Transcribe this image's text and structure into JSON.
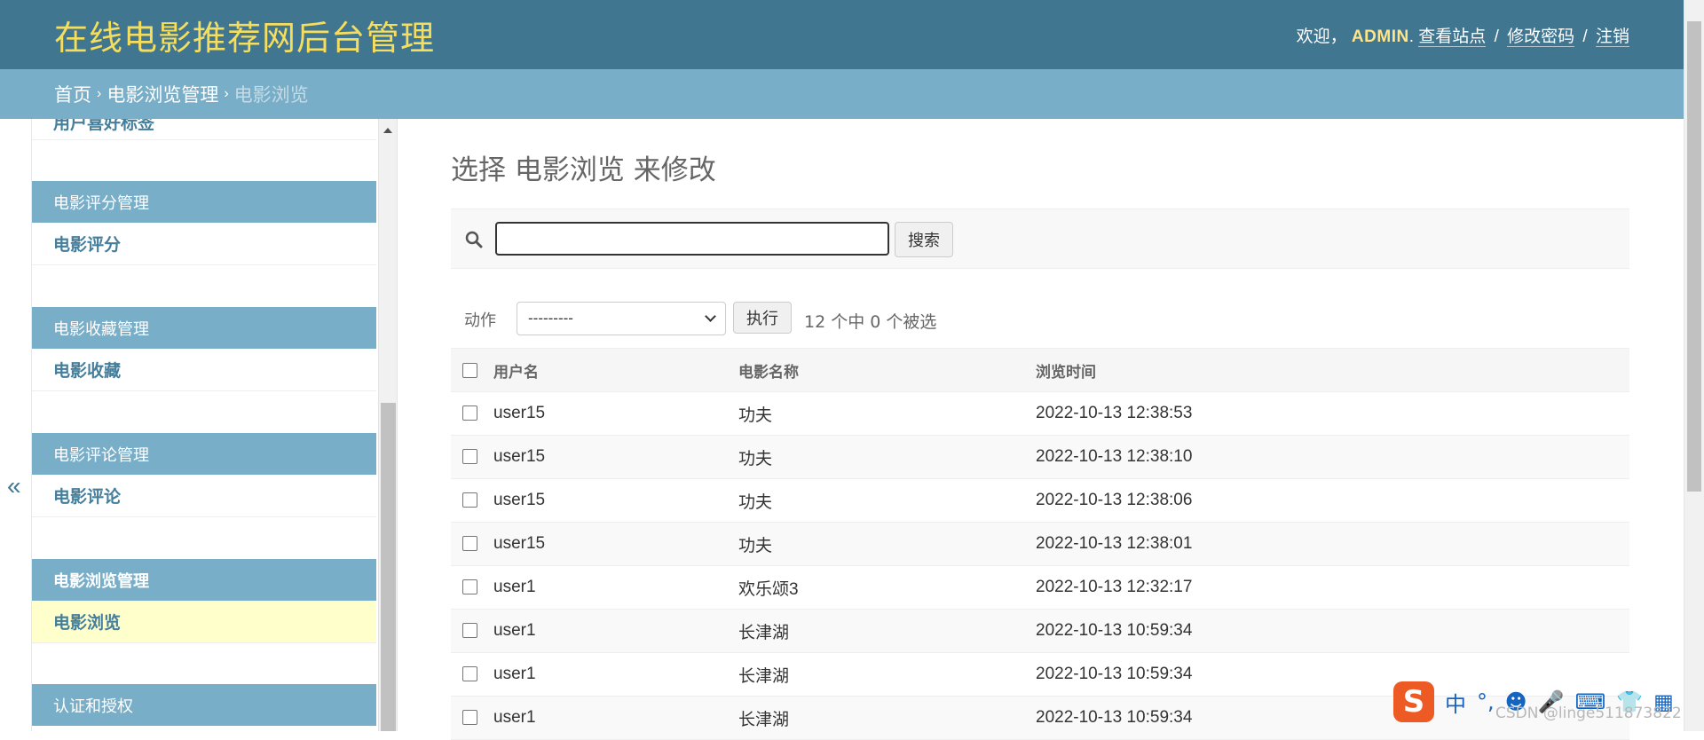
{
  "header": {
    "site_name": "在线电影推荐网后台管理",
    "welcome": "欢迎，",
    "username": "ADMIN",
    "links": [
      "查看站点",
      "修改密码",
      "注销"
    ]
  },
  "breadcrumbs": {
    "home": "首页",
    "app": "电影浏览管理",
    "current": "电影浏览"
  },
  "sidebar": {
    "toggle": "«",
    "remnant": "用户喜好标签",
    "modules": [
      {
        "caption": "电影评分管理",
        "item": "电影评分"
      },
      {
        "caption": "电影收藏管理",
        "item": "电影收藏"
      },
      {
        "caption": "电影评论管理",
        "item": "电影评论"
      },
      {
        "caption": "电影浏览管理",
        "item": "电影浏览"
      },
      {
        "caption": "认证和授权"
      }
    ]
  },
  "content": {
    "title": "选择 电影浏览 来修改",
    "search_button": "搜索",
    "search_value": "",
    "action_label": "动作",
    "action_selected": "---------",
    "go_button": "执行",
    "counter": "12 个中 0 个被选",
    "columns": [
      "用户名",
      "电影名称",
      "浏览时间"
    ],
    "rows": [
      [
        "user15",
        "功夫",
        "2022-10-13 12:38:53"
      ],
      [
        "user15",
        "功夫",
        "2022-10-13 12:38:10"
      ],
      [
        "user15",
        "功夫",
        "2022-10-13 12:38:06"
      ],
      [
        "user15",
        "功夫",
        "2022-10-13 12:38:01"
      ],
      [
        "user1",
        "欢乐颂3",
        "2022-10-13 12:32:17"
      ],
      [
        "user1",
        "长津湖",
        "2022-10-13 10:59:34"
      ],
      [
        "user1",
        "长津湖",
        "2022-10-13 10:59:34"
      ],
      [
        "user1",
        "长津湖",
        "2022-10-13 10:59:34"
      ]
    ]
  },
  "ime": {
    "logo": "S",
    "mode": "中",
    "punct": "°,",
    "watermark": "CSDN @linge511873822"
  },
  "colors": {
    "header_bg": "#417690",
    "breadcrumb_bg": "#79aec8",
    "site_name": "#f5dd5d",
    "link": "#447e9b",
    "current_row": "#ffffcc"
  }
}
